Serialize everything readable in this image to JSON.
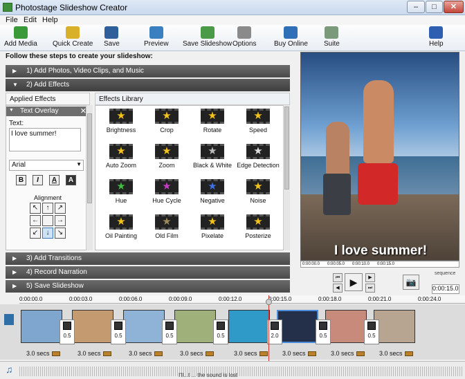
{
  "window": {
    "title": "Photostage Slideshow Creator",
    "min": "–",
    "max": "□",
    "close": "✕"
  },
  "menu": [
    "File",
    "Edit",
    "Help"
  ],
  "toolbar": [
    {
      "label": "Add Media",
      "icon": "add-media-icon",
      "color": "#3a9a3a"
    },
    {
      "label": "Quick Create",
      "icon": "magic-wand-icon",
      "color": "#d8b02a"
    },
    {
      "label": "Save",
      "icon": "floppy-disk-icon",
      "color": "#2f5f9a"
    },
    {
      "label": "Preview",
      "icon": "film-preview-icon",
      "color": "#3a7fc0"
    },
    {
      "label": "Save Slideshow",
      "icon": "save-slideshow-icon",
      "color": "#4a9a48"
    },
    {
      "label": "Options",
      "icon": "wrench-icon",
      "color": "#8a8a8a"
    },
    {
      "label": "Buy Online",
      "icon": "globe-icon",
      "color": "#2f6fb8"
    },
    {
      "label": "Suite",
      "icon": "suite-icon",
      "color": "#7a9a7a"
    },
    {
      "label": "Help",
      "icon": "help-icon",
      "color": "#2f5fb0"
    }
  ],
  "instructions": "Follow these steps to create your slideshow:",
  "steps": [
    {
      "label": "1)  Add Photos, Video Clips, and Music",
      "arrow": "▶"
    },
    {
      "label": "2)  Add Effects",
      "arrow": "▼"
    },
    {
      "label": "3)  Add Transitions",
      "arrow": "▶"
    },
    {
      "label": "4)  Record Narration",
      "arrow": "▶"
    },
    {
      "label": "5)  Save Slideshow",
      "arrow": "▶"
    }
  ],
  "applied_tab": "Applied Effects",
  "library_tab": "Effects Library",
  "text_overlay": {
    "title": "Text Overlay",
    "text_label": "Text:",
    "text_value": "I love summer!",
    "font": "Arial",
    "format_buttons": [
      "B",
      "I",
      "A",
      "A"
    ],
    "alignment_label": "Alignment",
    "alignment_arrows": [
      "↖",
      "↑",
      "↗",
      "←",
      "",
      "→",
      "↙",
      "↓",
      "↘"
    ],
    "alignment_selected_index": 7
  },
  "effects": [
    {
      "name": "Brightness",
      "color": "#f3c21c"
    },
    {
      "name": "Crop",
      "color": "#f3c21c"
    },
    {
      "name": "Rotate",
      "color": "#f3c21c"
    },
    {
      "name": "Speed",
      "color": "#f3c21c"
    },
    {
      "name": "Auto Zoom",
      "color": "#f3c21c"
    },
    {
      "name": "Zoom",
      "color": "#f3c21c"
    },
    {
      "name": "Black & White",
      "color": "#bbbbbb"
    },
    {
      "name": "Edge Detection",
      "color": "#dddddd"
    },
    {
      "name": "Hue",
      "color": "#3fbf3f"
    },
    {
      "name": "Hue Cycle",
      "color": "#c03fc0"
    },
    {
      "name": "Negative",
      "color": "#3f6fe0"
    },
    {
      "name": "Noise",
      "color": "#f3c21c"
    },
    {
      "name": "Oil Painting",
      "color": "#f3c21c"
    },
    {
      "name": "Old Film",
      "color": "#9a8a5a"
    },
    {
      "name": "Pixelate",
      "color": "#f3c21c"
    },
    {
      "name": "Posterize",
      "color": "#f3c21c"
    }
  ],
  "preview": {
    "caption": "I love summer!",
    "ruler_ticks": [
      "0:00:00.0",
      "0:00:05.0",
      "0:00:10.0",
      "0:00:15.0"
    ],
    "sequence_label": "sequence",
    "time": "0:00:15.0",
    "controls": {
      "rewind": "⏮",
      "prev": "◀",
      "play": "▶",
      "next": "▶",
      "end": "⏭",
      "snapshot": "📷"
    }
  },
  "timeline": {
    "ruler": [
      "0:00:00.0",
      "0:00:03.0",
      "0:00:06.0",
      "0:00:09.0",
      "0:00:12.0",
      "0:00:15.0",
      "0:00:18.0",
      "0:00:21.0",
      "0:00:24.0"
    ],
    "slides": [
      {
        "color": "#7fa6cf",
        "selected": false
      },
      {
        "color": "#c49a70",
        "selected": false
      },
      {
        "color": "#8fb3d6",
        "selected": false
      },
      {
        "color": "#9fb07a",
        "selected": false
      },
      {
        "color": "#2f9ac8",
        "selected": false
      },
      {
        "color": "#24304a",
        "selected": true
      },
      {
        "color": "#c88a7a",
        "selected": false
      },
      {
        "color": "#b7a592",
        "selected": false
      }
    ],
    "transitions": [
      "0.5",
      "0.5",
      "0.5",
      "0.5",
      "2.0",
      "0.5",
      "0.5"
    ],
    "durations": [
      "3.0 secs",
      "3.0 secs",
      "3.0 secs",
      "3.0 secs",
      "3.0 secs",
      "3.0 secs",
      "3.0 secs",
      "3.0 secs"
    ],
    "audio_text": "I'll...t ... the sound is lost"
  }
}
